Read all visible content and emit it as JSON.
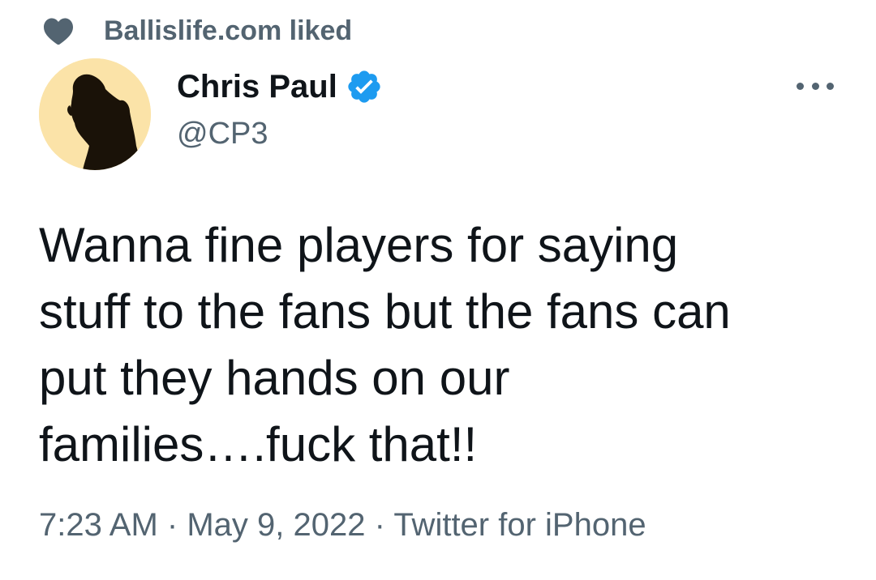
{
  "social_context": {
    "icon": "heart-icon",
    "text": "Ballislife.com liked"
  },
  "author": {
    "name": "Chris Paul",
    "handle": "@CP3",
    "verified": true,
    "verified_color": "#1d9bf0"
  },
  "more_icon": "more-horizontal-icon",
  "tweet": {
    "lines": [
      "Wanna fine players for saying",
      "stuff to the fans but the fans can",
      "put they hands on our",
      "families….fuck that!!"
    ]
  },
  "meta": {
    "time": "7:23 AM",
    "separator": "·",
    "date": "May 9, 2022",
    "source": "Twitter for iPhone"
  },
  "colors": {
    "text_primary": "#0f1419",
    "text_secondary": "#536471",
    "avatar_background": "#fbe3a8"
  }
}
